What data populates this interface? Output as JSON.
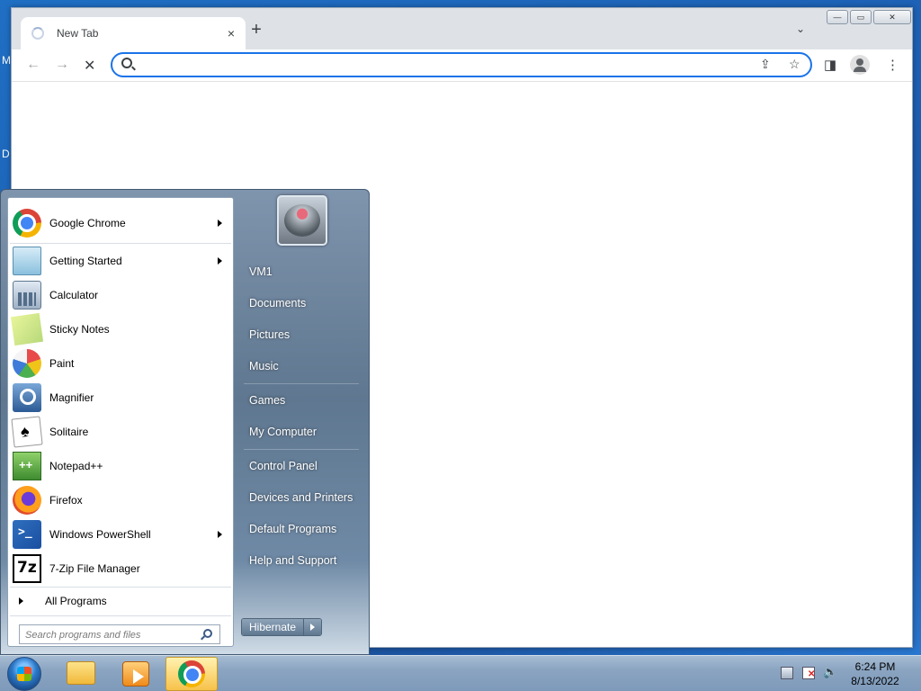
{
  "desktop": {
    "edge_chars": [
      "M",
      "D"
    ]
  },
  "browser": {
    "tab_title": "New Tab",
    "tab_close": "×",
    "new_tab": "+",
    "tab_search": "⌄",
    "window_controls": {
      "minimize": "—",
      "maximize": "▭",
      "close": "✕"
    },
    "nav": {
      "back": "←",
      "forward": "→",
      "stop": "✕"
    },
    "omnibox": {
      "value": "",
      "placeholder": ""
    },
    "icons": {
      "share": "⇪",
      "star": "☆",
      "sidepanel": "◨",
      "menu": "⋮"
    }
  },
  "start_menu": {
    "programs": [
      {
        "label": "Google Chrome",
        "icon": "chrome-icon",
        "submenu": true
      },
      {
        "label": "Getting Started",
        "icon": "getting-started-icon",
        "submenu": true
      },
      {
        "label": "Calculator",
        "icon": "calculator-icon",
        "submenu": false
      },
      {
        "label": "Sticky Notes",
        "icon": "sticky-notes-icon",
        "submenu": false
      },
      {
        "label": "Paint",
        "icon": "paint-icon",
        "submenu": false
      },
      {
        "label": "Magnifier",
        "icon": "magnifier-icon",
        "submenu": false
      },
      {
        "label": "Solitaire",
        "icon": "solitaire-icon",
        "submenu": false
      },
      {
        "label": "Notepad++",
        "icon": "notepad-plus-plus-icon",
        "submenu": false
      },
      {
        "label": "Firefox",
        "icon": "firefox-icon",
        "submenu": false
      },
      {
        "label": "Windows PowerShell",
        "icon": "powershell-icon",
        "submenu": true
      },
      {
        "label": "7-Zip File Manager",
        "icon": "seven-zip-icon",
        "submenu": false
      }
    ],
    "all_programs": "All Programs",
    "search_placeholder": "Search programs and files",
    "right_items": [
      "VM1",
      "Documents",
      "Pictures",
      "Music",
      "Games",
      "My Computer",
      "Control Panel",
      "Devices and Printers",
      "Default Programs",
      "Help and Support"
    ],
    "hibernate": "Hibernate"
  },
  "taskbar": {
    "time": "6:24 PM",
    "date": "8/13/2022"
  }
}
